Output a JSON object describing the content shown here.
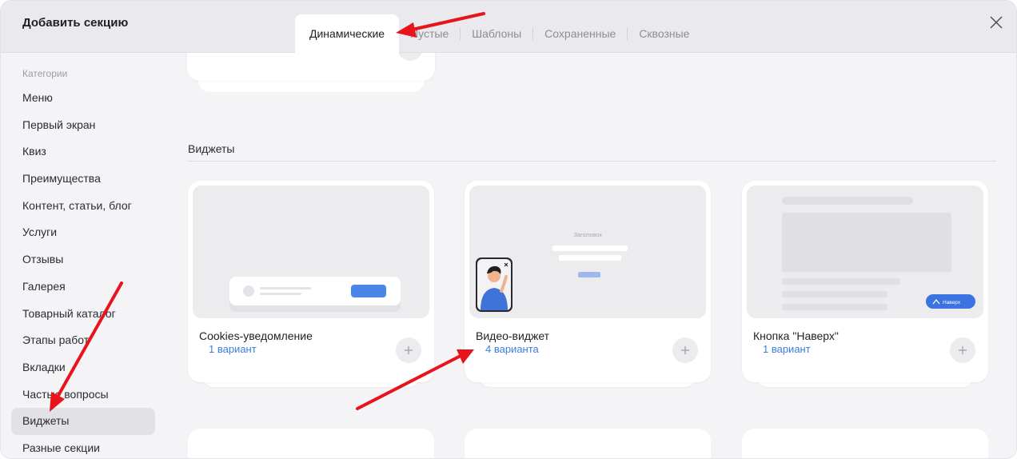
{
  "header": {
    "title": "Добавить секцию",
    "tabs": [
      {
        "label": "Динамические",
        "active": true
      },
      {
        "label": "Пустые",
        "active": false
      },
      {
        "label": "Шаблоны",
        "active": false
      },
      {
        "label": "Сохраненные",
        "active": false
      },
      {
        "label": "Сквозные",
        "active": false
      }
    ],
    "close_icon": "close-icon"
  },
  "sidebar": {
    "heading": "Категории",
    "items": [
      {
        "label": "Меню",
        "active": false
      },
      {
        "label": "Первый экран",
        "active": false
      },
      {
        "label": "Квиз",
        "active": false
      },
      {
        "label": "Преимущества",
        "active": false
      },
      {
        "label": "Контент, статьи, блог",
        "active": false
      },
      {
        "label": "Услуги",
        "active": false
      },
      {
        "label": "Отзывы",
        "active": false
      },
      {
        "label": "Галерея",
        "active": false
      },
      {
        "label": "Товарный каталог",
        "active": false
      },
      {
        "label": "Этапы работ",
        "active": false
      },
      {
        "label": "Вкладки",
        "active": false
      },
      {
        "label": "Частые вопросы",
        "active": false
      },
      {
        "label": "Виджеты",
        "active": true
      },
      {
        "label": "Разные секции",
        "active": false
      }
    ]
  },
  "main": {
    "section_title": "Виджеты",
    "cards": [
      {
        "title": "Cookies-уведомление",
        "variants": "1 вариант"
      },
      {
        "title": "Видео-виджет",
        "variants": "4 варианта",
        "preview_heading": "Заголовок"
      },
      {
        "title": "Кнопка \"Наверх\"",
        "variants": "1 вариант",
        "preview_button": "Наверх"
      }
    ]
  },
  "colors": {
    "accent": "#3b7de0",
    "preview_blue": "#4a86e8",
    "annotation_arrow": "#e8141c",
    "active_item_bg": "#e1e1e6"
  }
}
